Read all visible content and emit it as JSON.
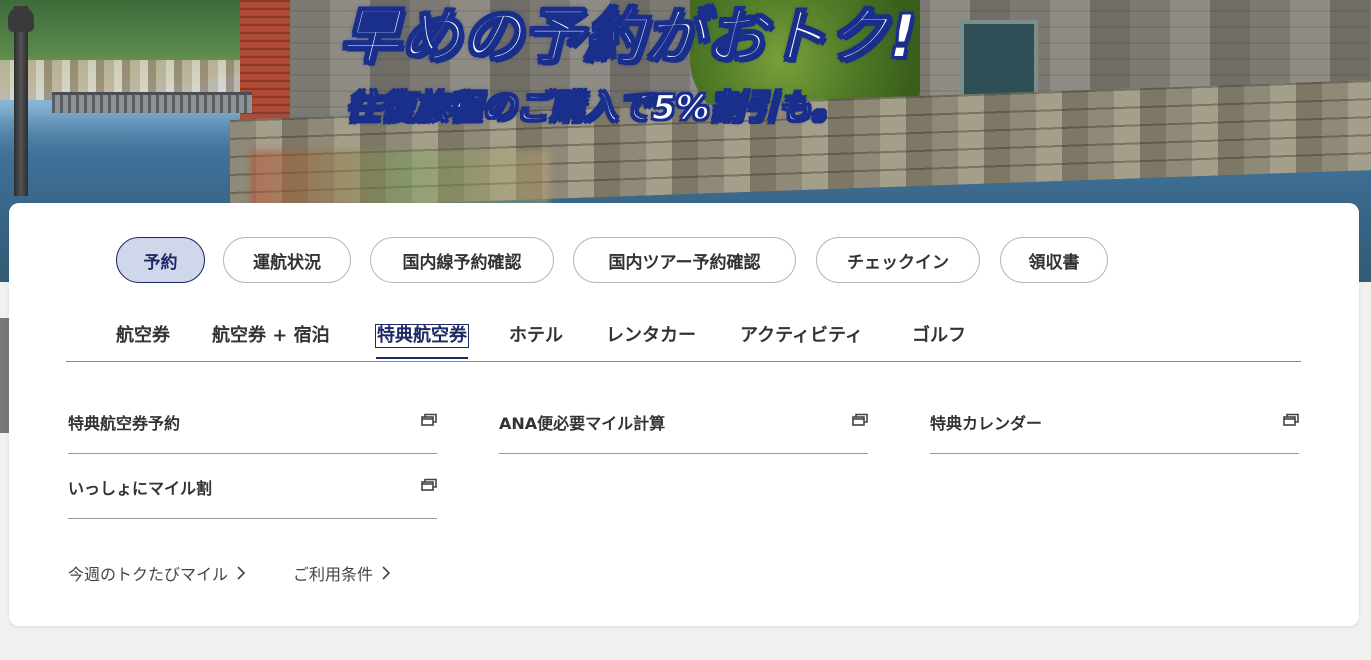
{
  "banner": {
    "headline": "早めの予約がおトク!",
    "subline": "往復旅程のご購入で5%割引も。"
  },
  "service_tabs": [
    {
      "label": "予約",
      "active": true
    },
    {
      "label": "運航状況",
      "active": false
    },
    {
      "label": "国内線予約確認",
      "active": false
    },
    {
      "label": "国内ツアー予約確認",
      "active": false
    },
    {
      "label": "チェックイン",
      "active": false
    },
    {
      "label": "領収書",
      "active": false
    }
  ],
  "product_tabs": [
    {
      "label": "航空券",
      "active": false
    },
    {
      "label": "航空券 + 宿泊",
      "active": false
    },
    {
      "label": "特典航空券",
      "active": true
    },
    {
      "label": "ホテル",
      "active": false
    },
    {
      "label": "レンタカー",
      "active": false
    },
    {
      "label": "アクティビティ",
      "active": false
    },
    {
      "label": "ゴルフ",
      "active": false
    }
  ],
  "links": [
    {
      "label": "特典航空券予約",
      "icon": "external-window-icon"
    },
    {
      "label": "ANA便必要マイル計算",
      "icon": "external-window-icon"
    },
    {
      "label": "特典カレンダー",
      "icon": "external-window-icon"
    },
    {
      "label": "いっしょにマイル割",
      "icon": "external-window-icon"
    }
  ],
  "footer_links": [
    {
      "label": "今週のトクたびマイル",
      "icon": "chevron-right-icon"
    },
    {
      "label": "ご利用条件",
      "icon": "chevron-right-icon"
    }
  ],
  "colors": {
    "active_tab_bg": "#d0d7ea",
    "active_tab_border": "#1c2a66",
    "headline_outline": "#1a2f8c"
  }
}
